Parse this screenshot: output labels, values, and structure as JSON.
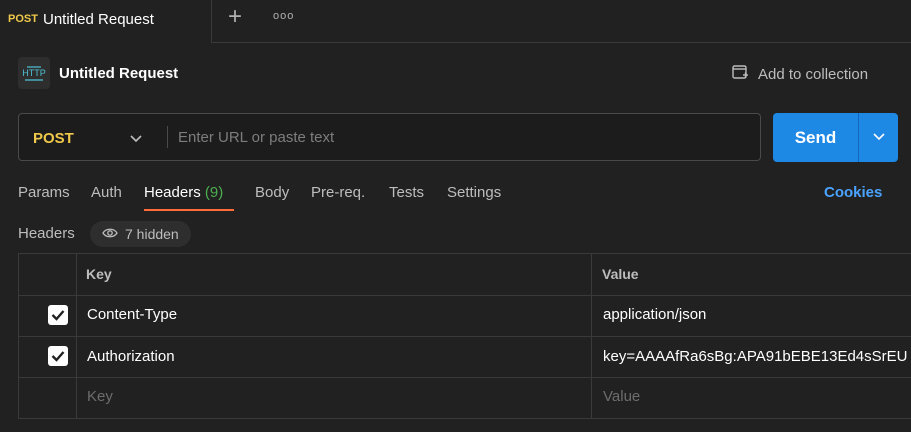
{
  "tab": {
    "method": "POST",
    "title": "Untitled Request",
    "add_label": "+",
    "more_label": "ooo"
  },
  "request": {
    "title": "Untitled Request",
    "icon_text": "HTTP",
    "add_to_collection": "Add to collection"
  },
  "url_bar": {
    "method": "POST",
    "placeholder": "Enter URL or paste text",
    "value": "",
    "send_label": "Send"
  },
  "req_tabs": [
    {
      "label": "Params"
    },
    {
      "label": "Auth"
    },
    {
      "label": "Headers",
      "count": "(9)",
      "active": true
    },
    {
      "label": "Body"
    },
    {
      "label": "Pre-req."
    },
    {
      "label": "Tests"
    },
    {
      "label": "Settings"
    }
  ],
  "cookies_label": "Cookies",
  "headers_section": {
    "label": "Headers",
    "hidden_label": "7 hidden"
  },
  "table": {
    "columns": [
      "Key",
      "Value"
    ],
    "rows": [
      {
        "checked": true,
        "key": "Content-Type",
        "value": "application/json"
      },
      {
        "checked": true,
        "key": "Authorization",
        "value": "key=AAAAfRa6sBg:APA91bEBE13Ed4sSrEU"
      }
    ],
    "placeholder_row": {
      "key": "Key",
      "value": "Value"
    }
  },
  "colors": {
    "accent": "#1e88e5",
    "method": "#f0c94a",
    "tab_underline": "#ff6c37",
    "count": "#4caf50",
    "link": "#4aa3ff"
  }
}
